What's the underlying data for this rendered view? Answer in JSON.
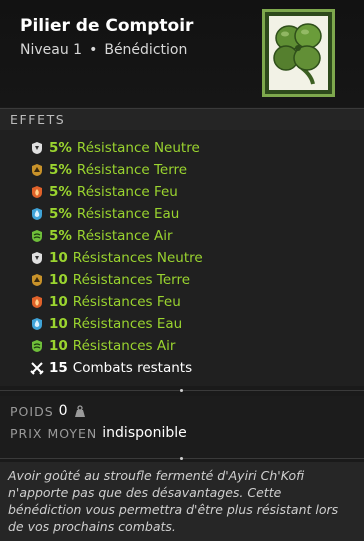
{
  "item": {
    "name": "Pilier de Comptoir",
    "level": "Niveau 1",
    "type": "Bénédiction"
  },
  "effects_header": "EFFETS",
  "effects": [
    {
      "value": "5%",
      "label": "Résistance Neutre",
      "element": "neutre"
    },
    {
      "value": "5%",
      "label": "Résistance Terre",
      "element": "terre"
    },
    {
      "value": "5%",
      "label": "Résistance Feu",
      "element": "feu"
    },
    {
      "value": "5%",
      "label": "Résistance Eau",
      "element": "eau"
    },
    {
      "value": "5%",
      "label": "Résistance Air",
      "element": "air"
    },
    {
      "value": "10",
      "label": "Résistances Neutre",
      "element": "neutre"
    },
    {
      "value": "10",
      "label": "Résistances Terre",
      "element": "terre"
    },
    {
      "value": "10",
      "label": "Résistances Feu",
      "element": "feu"
    },
    {
      "value": "10",
      "label": "Résistances Eau",
      "element": "eau"
    },
    {
      "value": "10",
      "label": "Résistances Air",
      "element": "air"
    },
    {
      "value": "15",
      "label": "Combats restants",
      "element": "combat"
    }
  ],
  "stats": {
    "weight_label": "POIDS",
    "weight_value": "0",
    "price_label": "PRIX MOYEN",
    "price_value": "indisponible"
  },
  "description": "Avoir goûté au stroufle fermenté d'Ayiri Ch'Kofi n'apporte pas que des désavantages. Cette bénédiction vous permettra d'être plus résistant lors de vos prochains combats.",
  "colors": {
    "effect_green": "#9ad42f",
    "frame_green": "#7ea84d",
    "neutre": "#e0e0e0",
    "terre": "#c8922a",
    "feu": "#e0622a",
    "eau": "#3fa3d8",
    "air": "#6fbf3a"
  }
}
